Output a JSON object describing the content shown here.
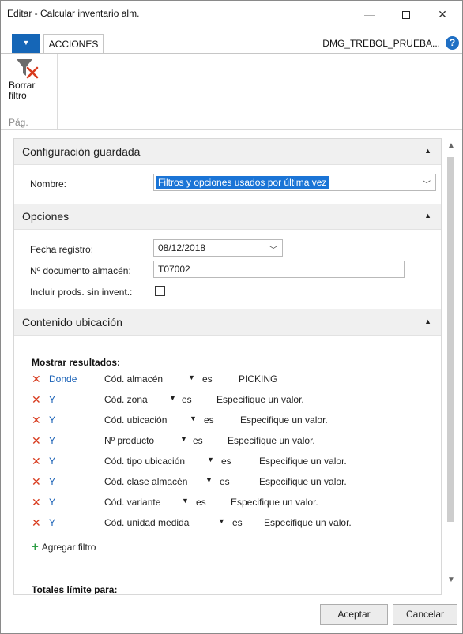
{
  "window": {
    "title": "Editar - Calcular inventario alm.",
    "minimize": "—",
    "close": "✕"
  },
  "ribbon": {
    "menu_arrow": "▼",
    "tab_label": "ACCIONES",
    "company": "DMG_TREBOL_PRUEBA...",
    "help": "?",
    "button_label_1": "Borrar",
    "button_label_2": "filtro",
    "group_name": "Pág."
  },
  "config": {
    "title": "Configuración guardada",
    "name_label": "Nombre:",
    "name_value": "Filtros y opciones usados por última vez"
  },
  "options": {
    "title": "Opciones",
    "date_label": "Fecha registro:",
    "date_value": "08/12/2018",
    "doc_label": "Nº documento almacén:",
    "doc_value": "T07002",
    "include_label": "Incluir prods. sin invent.:",
    "include_checked": false
  },
  "contents": {
    "title": "Contenido ubicación",
    "show_results": "Mostrar resultados:",
    "filters": [
      {
        "conj": "Donde",
        "field": "Cód. almacén",
        "op": "es",
        "value": "PICKING"
      },
      {
        "conj": "Y",
        "field": "Cód. zona",
        "op": "es",
        "value": "Especifique un valor."
      },
      {
        "conj": "Y",
        "field": "Cód. ubicación",
        "op": "es",
        "value": "Especifique un valor."
      },
      {
        "conj": "Y",
        "field": "Nº producto",
        "op": "es",
        "value": "Especifique un valor."
      },
      {
        "conj": "Y",
        "field": "Cód. tipo ubicación",
        "op": "es",
        "value": "Especifique un valor."
      },
      {
        "conj": "Y",
        "field": "Cód. clase almacén",
        "op": "es",
        "value": "Especifique un valor."
      },
      {
        "conj": "Y",
        "field": "Cód. variante",
        "op": "es",
        "value": "Especifique un valor."
      },
      {
        "conj": "Y",
        "field": "Cód. unidad medida",
        "op": "es",
        "value": "Especifique un valor."
      }
    ],
    "add_filter": "Agregar filtro",
    "limit_totals": "Totales límite para:"
  },
  "footer": {
    "accept": "Aceptar",
    "cancel": "Cancelar"
  },
  "colors": {
    "accent": "#1566b7",
    "link": "#1c63b7",
    "remove": "#d83b1e",
    "add": "#2e9e45"
  }
}
